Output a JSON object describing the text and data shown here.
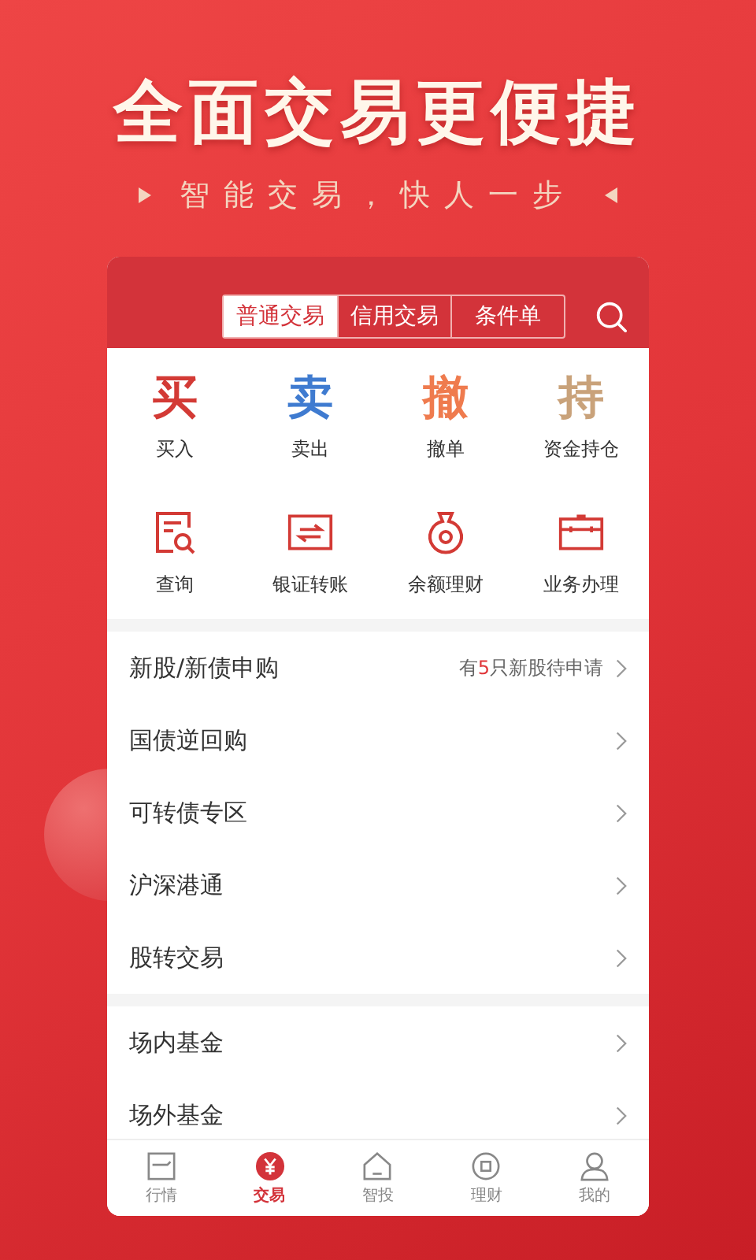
{
  "headline": "全面交易更便捷",
  "subtitle": "智能交易，快人一步",
  "tabs": [
    {
      "label": "普通交易",
      "selected": true
    },
    {
      "label": "信用交易",
      "selected": false
    },
    {
      "label": "条件单",
      "selected": false
    }
  ],
  "trade_actions": [
    {
      "glyph": "买",
      "label": "买入",
      "color": "#d33a35"
    },
    {
      "glyph": "卖",
      "label": "卖出",
      "color": "#3f7bd0"
    },
    {
      "glyph": "撤",
      "label": "撤单",
      "color": "#ef7b4e"
    },
    {
      "glyph": "持",
      "label": "资金持仓",
      "color": "#c9a27a"
    }
  ],
  "tools": [
    {
      "kind": "query",
      "label": "查询"
    },
    {
      "kind": "transfer",
      "label": "银证转账"
    },
    {
      "kind": "moneybag",
      "label": "余额理财"
    },
    {
      "kind": "briefcase",
      "label": "业务办理"
    }
  ],
  "sections": [
    [
      {
        "label": "新股/新债申购",
        "hint": "有**5**只新股待申请"
      },
      {
        "label": "国债逆回购"
      },
      {
        "label": "可转债专区"
      },
      {
        "label": "沪深港通"
      },
      {
        "label": "股转交易"
      }
    ],
    [
      {
        "label": "场内基金"
      },
      {
        "label": "场外基金"
      }
    ]
  ],
  "nav": [
    {
      "kind": "market",
      "label": "行情",
      "selected": false
    },
    {
      "kind": "trade",
      "label": "交易",
      "selected": true
    },
    {
      "kind": "home",
      "label": "智投",
      "selected": false
    },
    {
      "kind": "wealth",
      "label": "理财",
      "selected": false
    },
    {
      "kind": "me",
      "label": "我的",
      "selected": false
    }
  ]
}
